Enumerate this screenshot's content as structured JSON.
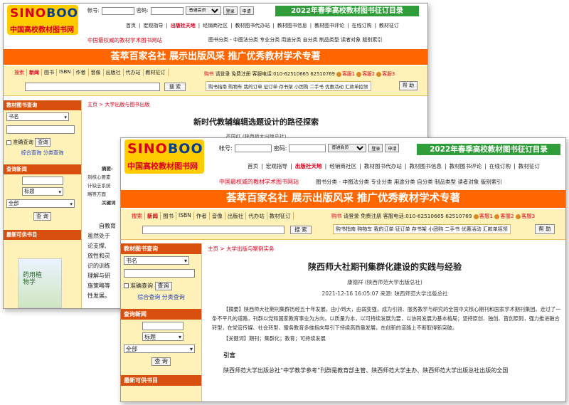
{
  "site": {
    "logo_main_a": "SINO",
    "logo_main_b": "BOOK",
    "logo_sub": "中国高校教材图书网",
    "login_account_label": "帐号:",
    "login_password_label": "密码:",
    "login_member_type": "普通会员",
    "login_button": "登录",
    "register_button": "申请",
    "banner_green": "2022年春季高校教材图书征订目录",
    "top_nav": [
      "首页",
      "宏观指导",
      "出版社天地",
      "经销商社区",
      "教材图书代办站",
      "教材图书信息",
      "教材图书评论",
      "在线订购",
      "教材征订"
    ],
    "authority": "中国最权威的教材学术图书网站",
    "category_nav": "图书分类 - 中图法分类  专业分类  用途分类  自分类  制品类型  读者对象  版别索引",
    "ribbon": "荟萃百家名社  展示出版风采  推广优秀教材学术专著",
    "search_label": "搜索",
    "search_tabs": [
      "新闻",
      "图书",
      "ISBN",
      "作者",
      "音像",
      "出版社",
      "代办站",
      "教材征订"
    ],
    "search_button": "搜 索",
    "cart_label": "购书",
    "cart_items": "请登录  免费注册  客服电话:010-62510665  62510769",
    "service_links": [
      "客服1",
      "客服2",
      "客服3"
    ],
    "cart_links": "购书指南 购物车 我的订单 征订单 存书架 小团购 二手书 优惠活动 汇款单招领",
    "help_button": "帮 助"
  },
  "sidebar": {
    "book_query_title": "教材图书查询",
    "book_query_field": "书名",
    "exact_query_label": "准确查询",
    "query_button": "查询",
    "combined_query_link": "综合查询",
    "category_query_link": "分类查询",
    "news_query_title": "查询新闻",
    "news_field": "标题",
    "news_scope": "全部",
    "news_query_button": "查 询",
    "newest_books_title": "最新可供书目",
    "book_cover_text": "药用植物学"
  },
  "back_page": {
    "breadcrumb_home": "主页",
    "breadcrumb_section": "大学出版与图书出版",
    "title": "新时代教辅编辑选题设计的路径探索",
    "author": "严国红  (陕西师大出版总社)",
    "abstract_label": "摘要:",
    "keywords_label": "关键词",
    "abstract_fragments": [
      "刻核心要素",
      "计缺乏系统",
      "略等方面"
    ],
    "body_fragments": [
      "自教育",
      "虽然处于",
      "论支撑,",
      "放性和灵",
      "识的训练",
      "理解与研",
      "施策略等",
      "性发展。"
    ]
  },
  "front_page": {
    "breadcrumb_home": "主页",
    "breadcrumb_section": "大学出版与案例实务",
    "title": "陕西师大社期刊集群化建设的实践与经验",
    "author": "康德祥  (陕西师范大学出版总社)",
    "date_source": "2021-12-16 16:05:07  来源:  陕西师范大学出版总社",
    "abstract_label": "【摘要】",
    "abstract": "陕西师大社期刊集群历经五十年发展，由小到大，由弱变强，成为引领、服务教学与研究的全国中文核心期刊和国家学术期刊集团。走过了一条不平凡的道路，刊群以党和国家教育事业为方向，以质量为本，以可持续发展为要，以协同发展为基本格局；坚持原创、独创、首创原则，强力推进融合转型，在党管传媒、社会转型、服务教育多维指向导引下持续高质量发展，在创新的道路上不断取得新突破。",
    "keywords_label": "【关键词】",
    "keywords": "期刊；集群化；教育；可持续发展",
    "intro_heading": "引言",
    "intro_text": "陕西师范大学出版总社“中学教学参考”刊群是教育部主管、陕西师范大学主办、陕西师范大学出版总社出版的全国"
  },
  "colors": {
    "brand_red": "#d9001b",
    "ribbon_orange": "#ff6600",
    "banner_green": "#2f9e3a",
    "search_bg": "#fff2b8",
    "sidebar_title": "#d9500e"
  }
}
